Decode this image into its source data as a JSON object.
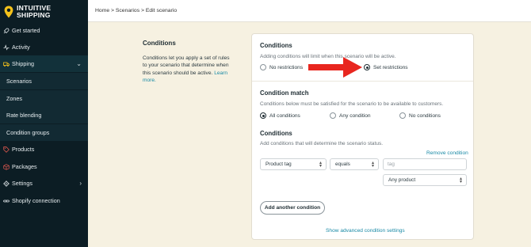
{
  "brand": {
    "name_line1": "INTUITIVE",
    "name_line2": "SHIPPING"
  },
  "sidebar": {
    "items": [
      {
        "label": "Get started",
        "icon": "rocket-icon"
      },
      {
        "label": "Activity",
        "icon": "pulse-icon"
      },
      {
        "label": "Shipping",
        "icon": "truck-icon"
      },
      {
        "label": "Scenarios"
      },
      {
        "label": "Zones"
      },
      {
        "label": "Rate blending"
      },
      {
        "label": "Condition groups"
      },
      {
        "label": "Products",
        "icon": "tag-icon"
      },
      {
        "label": "Packages",
        "icon": "box-icon"
      },
      {
        "label": "Settings",
        "icon": "gear-icon"
      },
      {
        "label": "Shopify connection",
        "icon": "link-icon"
      }
    ]
  },
  "breadcrumb": {
    "text": "Home > Scenarios > Edit scenario"
  },
  "intro": {
    "title": "Conditions",
    "text": "Conditions let you apply a set of rules to your scenario that determine when this scenario should be active.",
    "link": "Learn more."
  },
  "card": {
    "conditions": {
      "title": "Conditions",
      "subtitle": "Adding conditions will limit when this scenario will be active.",
      "options": [
        "No restrictions",
        "Set restrictions"
      ],
      "selected": "Set restrictions"
    },
    "match": {
      "title": "Condition match",
      "subtitle": "Conditions below must be satisfied for the scenario to be available to customers.",
      "options": [
        "All conditions",
        "Any condition",
        "No conditions"
      ],
      "selected": "All conditions"
    },
    "rules": {
      "title": "Conditions",
      "subtitle": "Add conditions that will determine the scenario status.",
      "remove_label": "Remove condition",
      "field_select": "Product tag",
      "operator_select": "equals",
      "value_placeholder": "tag",
      "scope_select": "Any product"
    },
    "add_button": "Add another condition",
    "advanced_link": "Show advanced condition settings"
  },
  "colors": {
    "sidebar_bg": "#0c1d24",
    "page_bg": "#f6f1e1",
    "link": "#1a8aa6",
    "arrow": "#e8261f"
  }
}
